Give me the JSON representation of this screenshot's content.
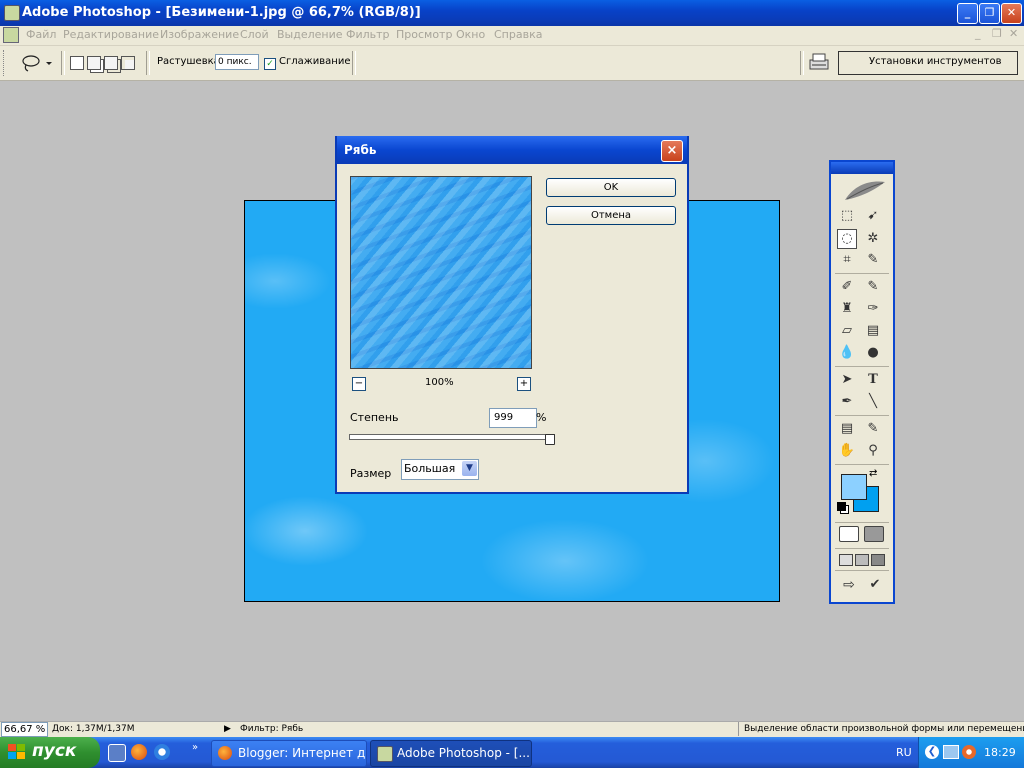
{
  "window": {
    "title": "Adobe Photoshop - [Безимени-1.jpg @ 66,7% (RGB/8)]"
  },
  "menu": [
    "Файл",
    "Редактирование",
    "Изображение",
    "Слой",
    "Выделение",
    "Фильтр",
    "Просмотр",
    "Окно",
    "Справка"
  ],
  "options": {
    "feather_label": "Растушевка:",
    "feather_value": "0 пикс.",
    "antialias_label": "Сглаживание",
    "antialias_checked": true,
    "presets_label": "Установки инструментов"
  },
  "dialog": {
    "title": "Рябь",
    "close": "×",
    "ok": "OK",
    "cancel": "Отмена",
    "zoom_out": "−",
    "zoom_in": "+",
    "zoom": "100%",
    "amount_label": "Степень",
    "amount_value": "999",
    "amount_unit": "%",
    "amount_slider_fraction": 1.0,
    "size_label": "Размер",
    "size_value": "Большая"
  },
  "colors": {
    "foreground": "#8cd0ff",
    "background": "#00a0f0",
    "canvas": "#22aaf4"
  },
  "status": {
    "zoom": "66,67 %",
    "doc": "Док: 1,37M/1,37M",
    "filter": "Фильтр: Рябь",
    "hint": "Выделение области произвольной формы или перемещение гра"
  },
  "taskbar": {
    "start": "пуск",
    "tasks": [
      {
        "label": "Blogger: Интернет д..."
      },
      {
        "label": "Adobe Photoshop - [..."
      }
    ],
    "lang": "RU",
    "clock": "18:29"
  }
}
